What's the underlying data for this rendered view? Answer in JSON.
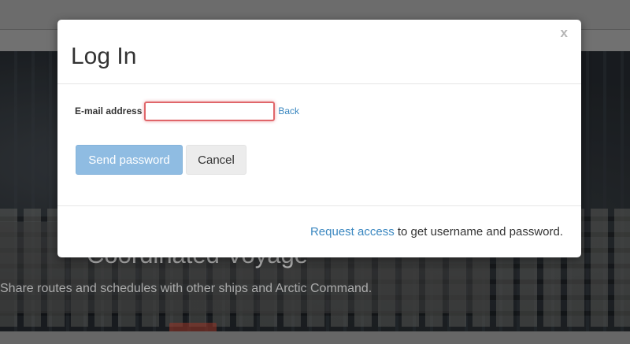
{
  "background": {
    "hero_title": "Coordinated Voyage",
    "hero_subtitle": "Share routes and schedules with other ships and Arctic Command."
  },
  "modal": {
    "title": "Log In",
    "close_label": "x",
    "email_label": "E-mail address",
    "email_value": "",
    "email_placeholder": "",
    "back_link": "Back",
    "send_button": "Send password",
    "cancel_button": "Cancel",
    "footer": {
      "link_text": "Request access",
      "trailing_text": " to get username and password."
    }
  },
  "colors": {
    "link": "#3a87c0",
    "primary_button": "#8fbce2",
    "input_error_border": "#e0666a"
  }
}
